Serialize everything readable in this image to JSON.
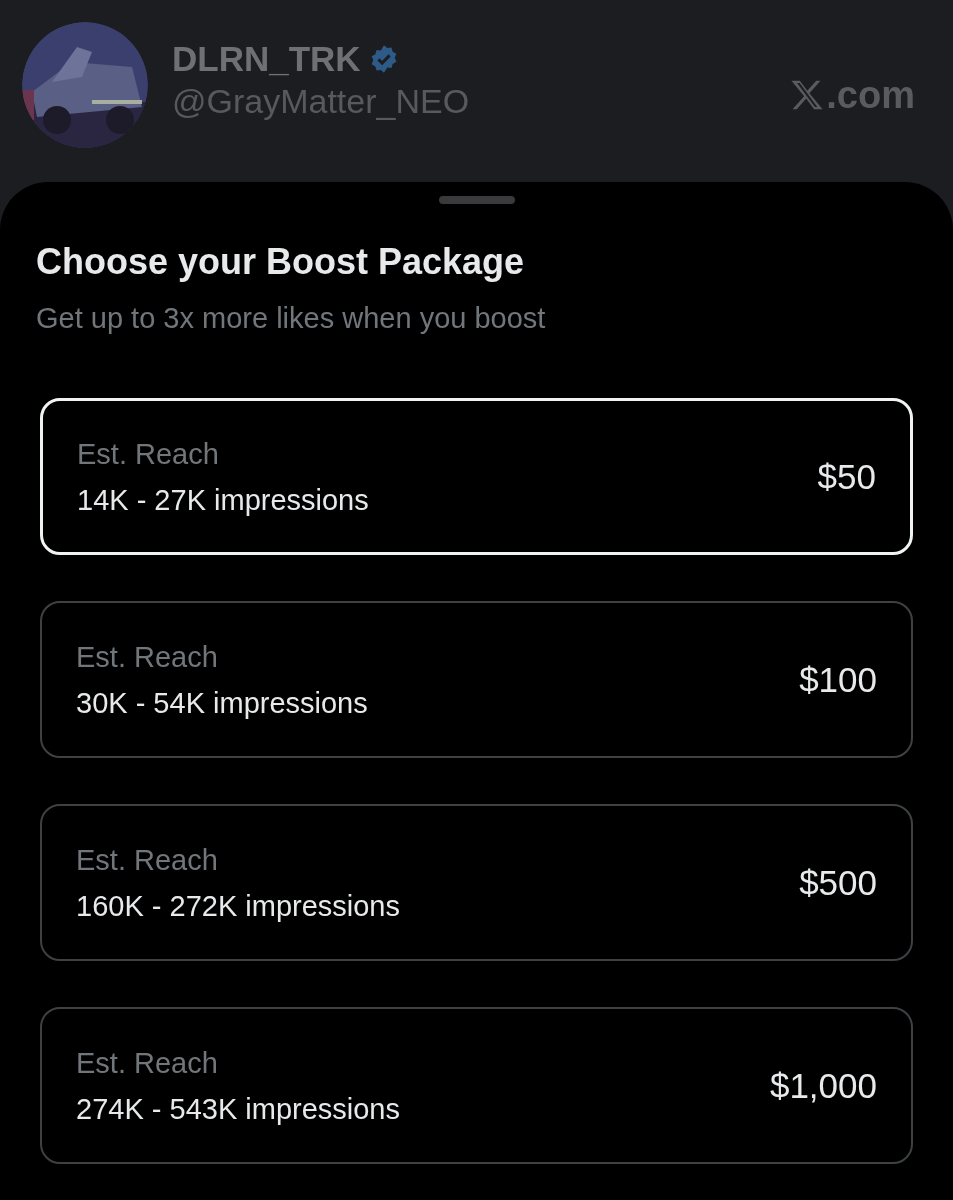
{
  "header": {
    "display_name": "DLRN_TRK",
    "verified": true,
    "handle": "@GrayMatter_NEO",
    "site": ".com"
  },
  "sheet": {
    "title": "Choose your Boost Package",
    "subtitle": "Get up to 3x more likes when you boost",
    "packages": [
      {
        "label": "Est. Reach",
        "reach": "14K - 27K impressions",
        "price": "$50",
        "selected": true
      },
      {
        "label": "Est. Reach",
        "reach": "30K - 54K impressions",
        "price": "$100",
        "selected": false
      },
      {
        "label": "Est. Reach",
        "reach": "160K - 272K impressions",
        "price": "$500",
        "selected": false
      },
      {
        "label": "Est. Reach",
        "reach": "274K - 543K impressions",
        "price": "$1,000",
        "selected": false
      }
    ]
  }
}
